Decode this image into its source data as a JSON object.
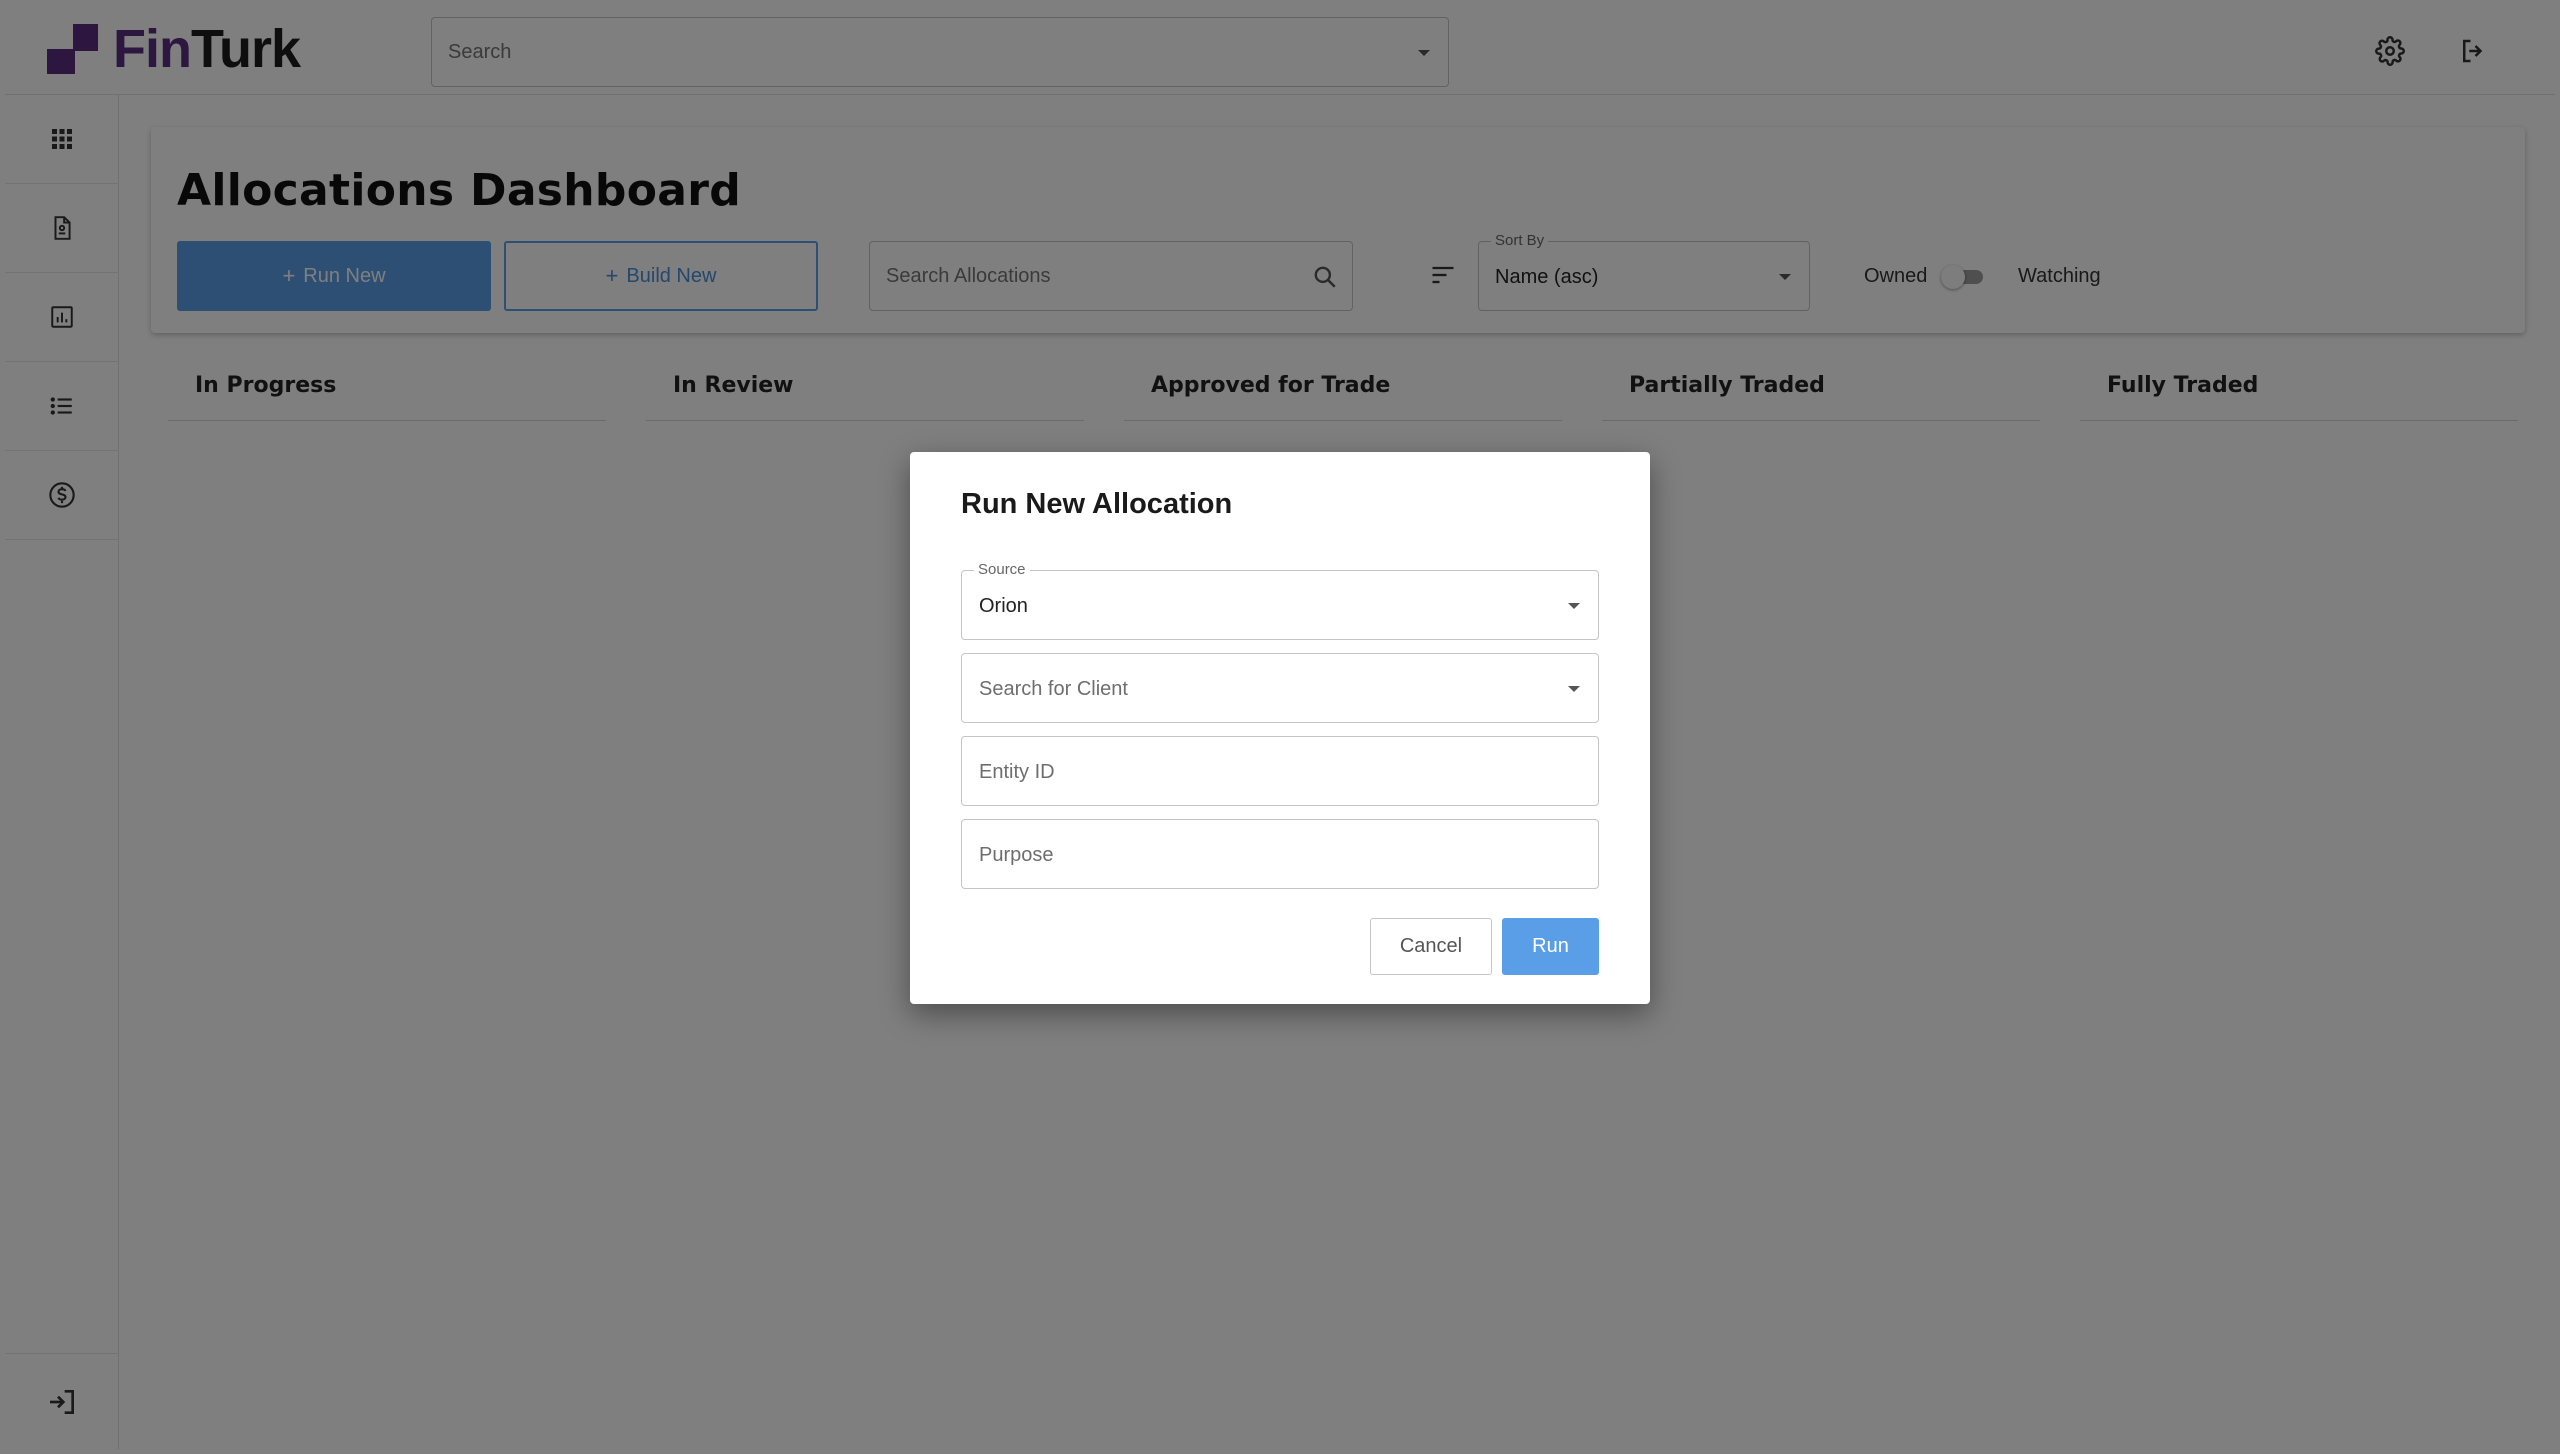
{
  "brand": {
    "name_part1": "Fin",
    "name_part2": "Turk",
    "color": "#5b2e80"
  },
  "topbar": {
    "search_placeholder": "Search",
    "icons": [
      "gear-icon",
      "logout-icon"
    ]
  },
  "sidebar": {
    "items": [
      {
        "icon": "apps-grid-icon"
      },
      {
        "icon": "document-icon"
      },
      {
        "icon": "bar-chart-icon"
      },
      {
        "icon": "list-icon"
      },
      {
        "icon": "dollar-circle-icon"
      }
    ],
    "bottom_icon": "login-icon"
  },
  "dashboard": {
    "title": "Allocations Dashboard",
    "run_new_label": "Run New",
    "build_new_label": "Build New",
    "search_placeholder": "Search Allocations",
    "sort_by_legend": "Sort By",
    "sort_by_value": "Name (asc)",
    "owned_label": "Owned",
    "watching_label": "Watching",
    "toggle_on": false,
    "accent_color": "#5a9ee8",
    "columns": [
      "In Progress",
      "In Review",
      "Approved for Trade",
      "Partially Traded",
      "Fully Traded"
    ]
  },
  "dialog": {
    "title": "Run New Allocation",
    "source_legend": "Source",
    "source_value": "Orion",
    "client_placeholder": "Search for Client",
    "entity_placeholder": "Entity ID",
    "purpose_placeholder": "Purpose",
    "cancel_label": "Cancel",
    "run_label": "Run"
  }
}
